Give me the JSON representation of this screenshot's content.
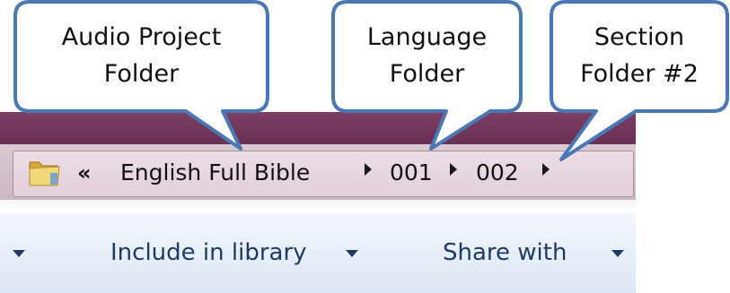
{
  "callouts": [
    {
      "lines": [
        "Audio Project",
        "Folder"
      ],
      "points_to": "English Full Bible"
    },
    {
      "lines": [
        "Language",
        "Folder"
      ],
      "points_to": "001"
    },
    {
      "lines": [
        "Section",
        "Folder #2"
      ],
      "points_to": "002"
    }
  ],
  "address_bar": {
    "folder_icon": "folder-icon",
    "overflow_glyph": "«",
    "crumbs": [
      "English Full Bible",
      "001",
      "002"
    ]
  },
  "toolbar": {
    "include_label": "Include in library",
    "share_label": "Share with"
  },
  "colors": {
    "callout_border": "#4a78b4",
    "title_strip": "#6f3459",
    "address_bar": "#d3c2cc",
    "toolbar": "#e6eef8",
    "toolbar_text": "#1f3a64"
  }
}
